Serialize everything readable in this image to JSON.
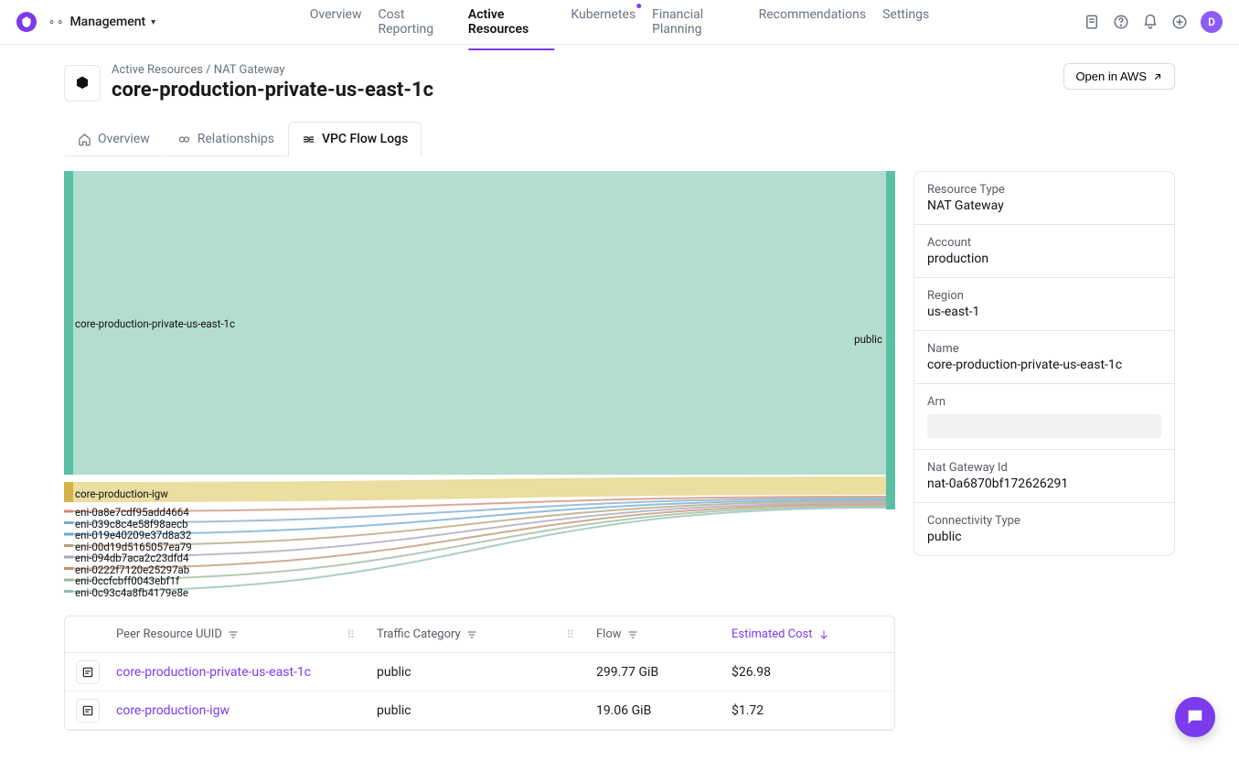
{
  "workspace": {
    "label": "Management"
  },
  "topnav": {
    "overview": "Overview",
    "cost_reporting": "Cost Reporting",
    "active_resources": "Active Resources",
    "kubernetes": "Kubernetes",
    "financial_planning": "Financial Planning",
    "recommendations": "Recommendations",
    "settings": "Settings"
  },
  "avatar_initial": "D",
  "breadcrumbs": {
    "parent": "Active Resources",
    "current": "NAT Gateway"
  },
  "page_title": "core-production-private-us-east-1c",
  "open_aws_label": "Open in AWS",
  "tabs": {
    "overview": "Overview",
    "relationships": "Relationships",
    "flow_logs": "VPC Flow Logs"
  },
  "sankey": {
    "main_source": "core-production-private-us-east-1c",
    "target": "public",
    "igw": "core-production-igw",
    "enis": [
      "eni-0a8e7cdf95add4664",
      "eni-039c8c4e58f98aecb",
      "eni-019e40209e37d8a32",
      "eni-00d19d5165057ea79",
      "eni-094db7aca2c23dfd4",
      "eni-0222f7120e25297ab",
      "eni-0ccfcbff0043ebf1f",
      "eni-0c93c4a8fb4179e8e"
    ]
  },
  "info": {
    "resource_type": {
      "label": "Resource Type",
      "value": "NAT Gateway"
    },
    "account": {
      "label": "Account",
      "value": "production"
    },
    "region": {
      "label": "Region",
      "value": "us-east-1"
    },
    "name": {
      "label": "Name",
      "value": "core-production-private-us-east-1c"
    },
    "arn": {
      "label": "Arn",
      "value": ""
    },
    "nat_id": {
      "label": "Nat Gateway Id",
      "value": "nat-0a6870bf172626291"
    },
    "connectivity": {
      "label": "Connectivity Type",
      "value": "public"
    }
  },
  "table": {
    "headers": {
      "peer": "Peer Resource UUID",
      "category": "Traffic Category",
      "flow": "Flow",
      "cost": "Estimated Cost"
    },
    "rows": [
      {
        "peer": "core-production-private-us-east-1c",
        "category": "public",
        "flow": "299.77 GiB",
        "cost": "$26.98"
      },
      {
        "peer": "core-production-igw",
        "category": "public",
        "flow": "19.06 GiB",
        "cost": "$1.72"
      }
    ]
  },
  "chart_data": {
    "type": "sankey",
    "title": "VPC Flow Logs",
    "nodes": [
      "core-production-private-us-east-1c",
      "core-production-igw",
      "eni-0a8e7cdf95add4664",
      "eni-039c8c4e58f98aecb",
      "eni-019e40209e37d8a32",
      "eni-00d19d5165057ea79",
      "eni-094db7aca2c23dfd4",
      "eni-0222f7120e25297ab",
      "eni-0ccfcbff0043ebf1f",
      "eni-0c93c4a8fb4179e8e",
      "public"
    ],
    "links": [
      {
        "source": "core-production-private-us-east-1c",
        "target": "public",
        "value_gib": 299.77,
        "cost_usd": 26.98
      },
      {
        "source": "core-production-igw",
        "target": "public",
        "value_gib": 19.06,
        "cost_usd": 1.72
      },
      {
        "source": "eni-0a8e7cdf95add4664",
        "target": "public",
        "value_gib": 1.3
      },
      {
        "source": "eni-039c8c4e58f98aecb",
        "target": "public",
        "value_gib": 1.2
      },
      {
        "source": "eni-019e40209e37d8a32",
        "target": "public",
        "value_gib": 1.1
      },
      {
        "source": "eni-00d19d5165057ea79",
        "target": "public",
        "value_gib": 1.0
      },
      {
        "source": "eni-094db7aca2c23dfd4",
        "target": "public",
        "value_gib": 0.9
      },
      {
        "source": "eni-0222f7120e25297ab",
        "target": "public",
        "value_gib": 0.8
      },
      {
        "source": "eni-0ccfcbff0043ebf1f",
        "target": "public",
        "value_gib": 0.7
      },
      {
        "source": "eni-0c93c4a8fb4179e8e",
        "target": "public",
        "value_gib": 0.6
      }
    ]
  }
}
